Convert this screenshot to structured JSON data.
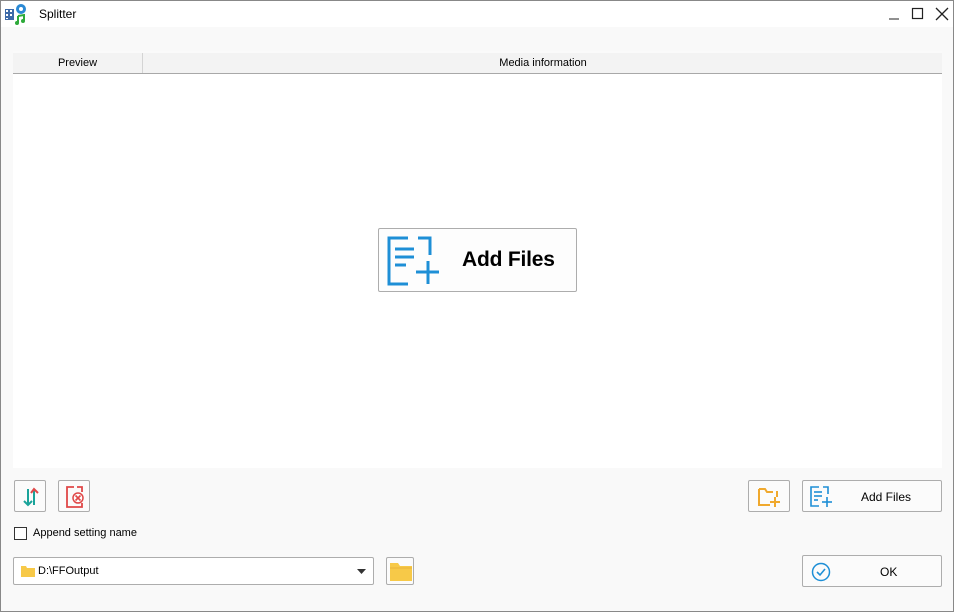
{
  "window": {
    "title": "Splitter"
  },
  "table": {
    "columns": [
      "Preview",
      "Media information"
    ]
  },
  "center_button": {
    "label": "Add Files"
  },
  "toolbar": {
    "add_files_label": "Add Files"
  },
  "options": {
    "append_setting_name_label": "Append setting name",
    "append_setting_name_checked": false
  },
  "output": {
    "path": "D:\\FFOutput"
  },
  "footer": {
    "ok_label": "OK"
  },
  "colors": {
    "accent_blue": "#1e8fd6",
    "folder_yellow": "#f7c948",
    "delete_red": "#e04848",
    "swap_teal": "#1aa39a"
  },
  "icons": {
    "app": "splitter-app-icon",
    "minimize": "minimize-icon",
    "maximize": "maximize-icon",
    "close": "close-icon",
    "add_files": "add-files-icon",
    "sort": "sort-icon",
    "remove": "remove-file-icon",
    "add_folder": "add-folder-icon",
    "folder": "folder-icon",
    "dropdown": "chevron-down-icon",
    "ok": "check-circle-icon"
  }
}
